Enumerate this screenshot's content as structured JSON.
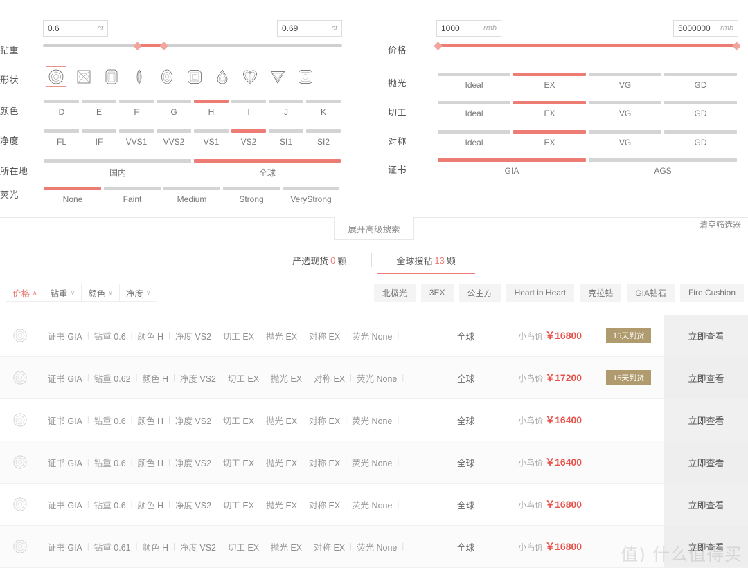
{
  "filters": {
    "carat": {
      "label": "钻重",
      "min_value": "0.6",
      "max_value": "0.69",
      "unit": "ct",
      "placeholder_min": "0.6",
      "placeholder_max": "0.69"
    },
    "shape": {
      "label": "形状",
      "options": [
        {
          "name": "round",
          "selected": true
        },
        {
          "name": "princess",
          "selected": false
        },
        {
          "name": "emerald",
          "selected": false
        },
        {
          "name": "marquise",
          "selected": false
        },
        {
          "name": "oval",
          "selected": false
        },
        {
          "name": "radiant",
          "selected": false
        },
        {
          "name": "pear",
          "selected": false
        },
        {
          "name": "heart",
          "selected": false
        },
        {
          "name": "triangle",
          "selected": false
        },
        {
          "name": "cushion",
          "selected": false
        }
      ]
    },
    "color": {
      "label": "颜色",
      "options": [
        "D",
        "E",
        "F",
        "G",
        "H",
        "I",
        "J",
        "K"
      ],
      "selected": [
        "H"
      ]
    },
    "clarity": {
      "label": "净度",
      "options": [
        "FL",
        "IF",
        "VVS1",
        "VVS2",
        "VS1",
        "VS2",
        "SI1",
        "SI2"
      ],
      "selected": [
        "VS2"
      ]
    },
    "location": {
      "label": "所在地",
      "options": [
        "国内",
        "全球"
      ],
      "selected": [
        "全球"
      ]
    },
    "fluorescence": {
      "label": "荧光",
      "options": [
        "None",
        "Faint",
        "Medium",
        "Strong",
        "VeryStrong"
      ],
      "selected": [
        "None"
      ]
    },
    "price": {
      "label": "价格",
      "min_value": "1000",
      "max_value": "5000000",
      "unit": "rmb",
      "placeholder_min": "1000",
      "placeholder_max": "5000000"
    },
    "polish": {
      "label": "抛光",
      "options": [
        "Ideal",
        "EX",
        "VG",
        "GD"
      ],
      "selected": [
        "EX"
      ]
    },
    "cut": {
      "label": "切工",
      "options": [
        "Ideal",
        "EX",
        "VG",
        "GD"
      ],
      "selected": [
        "EX"
      ]
    },
    "symmetry": {
      "label": "对称",
      "options": [
        "Ideal",
        "EX",
        "VG",
        "GD"
      ],
      "selected": [
        "EX"
      ]
    },
    "certificate": {
      "label": "证书",
      "options": [
        "GIA",
        "AGS"
      ],
      "selected": [
        "GIA"
      ]
    },
    "advanced_button": "展开高级搜索",
    "clear_link": "清空筛选器"
  },
  "tabs": [
    {
      "label_prefix": "严选现货",
      "count": "0",
      "label_suffix": "颗",
      "active": false
    },
    {
      "label_prefix": "全球搜钻",
      "count": "13",
      "label_suffix": "颗",
      "active": true
    }
  ],
  "sorts": [
    {
      "label": "价格",
      "arrow": "∧",
      "active": true
    },
    {
      "label": "钻重",
      "arrow": "∨",
      "active": false
    },
    {
      "label": "颜色",
      "arrow": "∨",
      "active": false
    },
    {
      "label": "净度",
      "arrow": "∨",
      "active": false
    }
  ],
  "tags": [
    "北极光",
    "3EX",
    "公主方",
    "Heart in Heart",
    "克拉钻",
    "GIA钻石",
    "Fire Cushion"
  ],
  "spec_keys": {
    "cert": "证书",
    "carat": "钻重",
    "color": "颜色",
    "clarity": "净度",
    "cut": "切工",
    "polish": "抛光",
    "symmetry": "对称",
    "fluorescence": "荧光"
  },
  "price_label": "小鸟价",
  "currency": "￥",
  "view_button": "立即查看",
  "rows": [
    {
      "cert": "GIA",
      "carat": "0.6",
      "color": "H",
      "clarity": "VS2",
      "cut": "EX",
      "polish": "EX",
      "symmetry": "EX",
      "fluorescence": "None",
      "region": "全球",
      "price": "16800",
      "badge": "15天到货"
    },
    {
      "cert": "GIA",
      "carat": "0.62",
      "color": "H",
      "clarity": "VS2",
      "cut": "EX",
      "polish": "EX",
      "symmetry": "EX",
      "fluorescence": "None",
      "region": "全球",
      "price": "17200",
      "badge": "15天到货"
    },
    {
      "cert": "GIA",
      "carat": "0.6",
      "color": "H",
      "clarity": "VS2",
      "cut": "EX",
      "polish": "EX",
      "symmetry": "EX",
      "fluorescence": "None",
      "region": "全球",
      "price": "16400",
      "badge": ""
    },
    {
      "cert": "GIA",
      "carat": "0.6",
      "color": "H",
      "clarity": "VS2",
      "cut": "EX",
      "polish": "EX",
      "symmetry": "EX",
      "fluorescence": "None",
      "region": "全球",
      "price": "16400",
      "badge": ""
    },
    {
      "cert": "GIA",
      "carat": "0.6",
      "color": "H",
      "clarity": "VS2",
      "cut": "EX",
      "polish": "EX",
      "symmetry": "EX",
      "fluorescence": "None",
      "region": "全球",
      "price": "16800",
      "badge": ""
    },
    {
      "cert": "GIA",
      "carat": "0.61",
      "color": "H",
      "clarity": "VS2",
      "cut": "EX",
      "polish": "EX",
      "symmetry": "EX",
      "fluorescence": "None",
      "region": "全球",
      "price": "16800",
      "badge": ""
    }
  ],
  "watermark": "值) 什么值得买",
  "colors": {
    "accent": "#ec7c74",
    "price": "#e8534c",
    "badge": "#b09b6f",
    "track": "#d4d4d4"
  }
}
